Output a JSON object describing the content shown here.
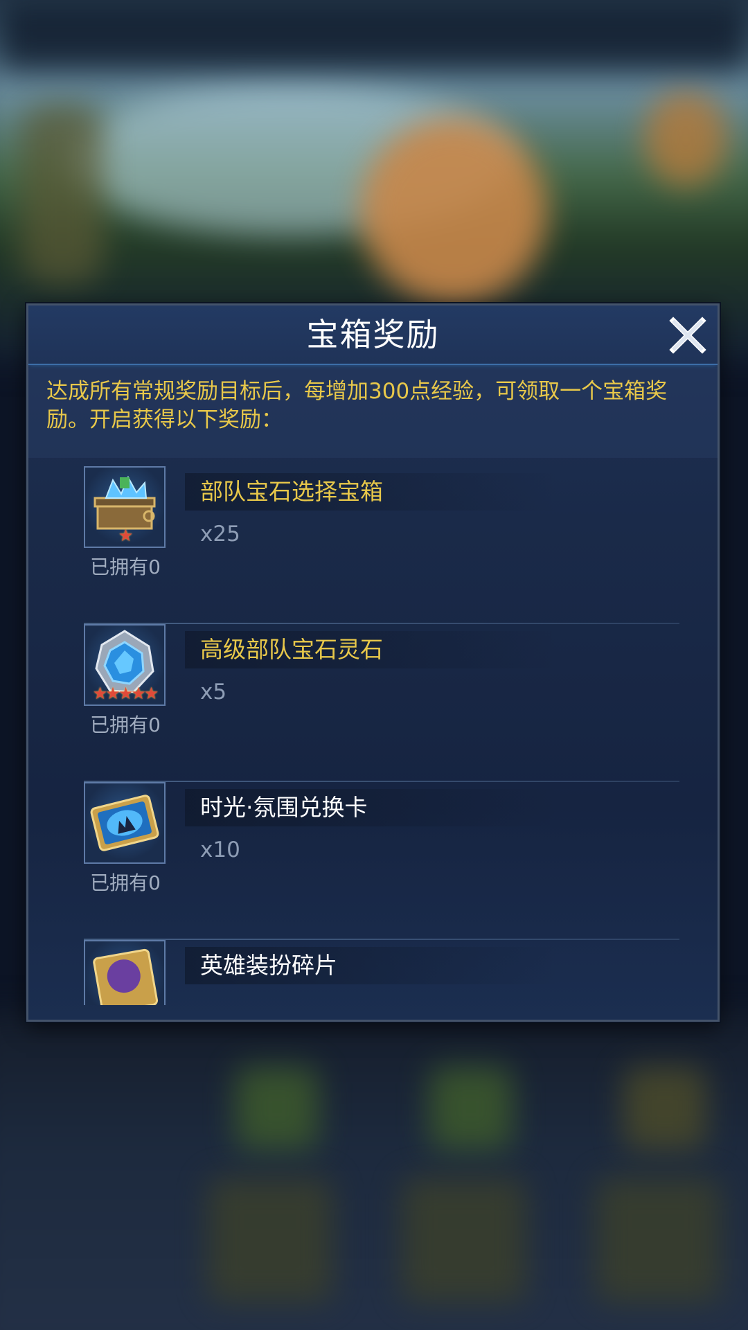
{
  "dialog": {
    "title": "宝箱奖励",
    "intro": "达成所有常规奖励目标后，每增加300点经验，可领取一个宝箱奖励。开启获得以下奖励："
  },
  "rewards": [
    {
      "name": "部队宝石选择宝箱",
      "qty": "x25",
      "owned": "已拥有0",
      "name_color": "gold",
      "icon": "treasure-chest-icon",
      "stars": "★"
    },
    {
      "name": "高级部队宝石灵石",
      "qty": "x5",
      "owned": "已拥有0",
      "name_color": "gold",
      "icon": "spirit-stone-icon",
      "stars": "★★★★★"
    },
    {
      "name": "时光·氛围兑换卡",
      "qty": "x10",
      "owned": "已拥有0",
      "name_color": "white",
      "icon": "exchange-card-icon",
      "stars": ""
    },
    {
      "name": "英雄装扮碎片",
      "qty": "",
      "owned": "",
      "name_color": "white",
      "icon": "costume-fragment-icon",
      "stars": ""
    }
  ],
  "colors": {
    "gold": "#e8c84a",
    "panel": "#1a2a49"
  }
}
